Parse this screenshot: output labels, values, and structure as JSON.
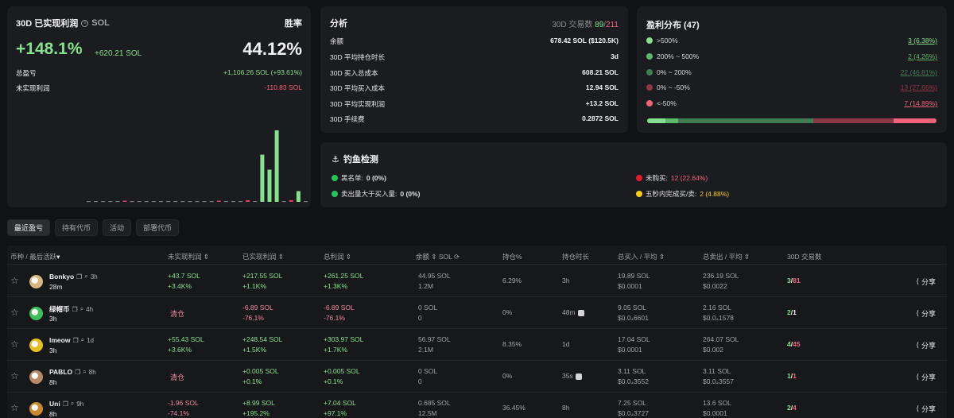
{
  "pnl_card": {
    "title": "30D 已实现利润",
    "currency": "SOL",
    "winrate_label": "胜率",
    "realized_pct": "+148.1%",
    "realized_sol": "+620.21 SOL",
    "winrate_value": "44.12%",
    "total_pnl_label": "总盈亏",
    "total_pnl_value": "+1,106.26 SOL (+93.61%)",
    "unrealized_label": "未实现利润",
    "unrealized_value": "-110.83 SOL",
    "bars": [
      0,
      0,
      0,
      0,
      0,
      0.012,
      0,
      0,
      0,
      0,
      0,
      0,
      0,
      0,
      0,
      0,
      0,
      0,
      0.012,
      0,
      0,
      0,
      0.024,
      0,
      0.66,
      0.45,
      1.0,
      0,
      0.024,
      0.15,
      0
    ],
    "bar_colors": {
      "positive": "#86e08e",
      "negative": "#e0405c",
      "neutral": "#7a7b80"
    }
  },
  "analysis": {
    "title": "分析",
    "trades_label": "30D 交易数",
    "trades_win": "89",
    "trades_sep": "/",
    "trades_total": "211",
    "rows": [
      {
        "label": "余额",
        "value": "678.42 SOL ($120.5K)"
      },
      {
        "label": "30D 平均持仓时长",
        "value": "3d"
      },
      {
        "label": "30D 买入总成本",
        "value": "608.21 SOL"
      },
      {
        "label": "30D 平均买入成本",
        "value": "12.94 SOL"
      },
      {
        "label": "30D 平均实现利润",
        "value": "+13.2 SOL"
      },
      {
        "label": "30D 手续费",
        "value": "0.2872 SOL"
      }
    ]
  },
  "profit_dist": {
    "title": "盈利分布 (47)",
    "rows": [
      {
        "label": ">500%",
        "count": "3 (6.38%)",
        "color": "#86e08e",
        "share": 0.0638
      },
      {
        "label": "200% ~ 500%",
        "count": "2 (4.26%)",
        "color": "#5cb86a",
        "share": 0.0426
      },
      {
        "label": "0% ~ 200%",
        "count": "22 (46.81%)",
        "color": "#3f7d52",
        "share": 0.4681
      },
      {
        "label": "0% ~ -50%",
        "count": "13 (27.66%)",
        "color": "#8f3646",
        "share": 0.2766
      },
      {
        "label": "<-50%",
        "count": "7 (14.89%)",
        "color": "#f2637b",
        "share": 0.1489
      }
    ]
  },
  "phishing": {
    "title": "钓鱼检测",
    "items": [
      {
        "label": "黑名单:",
        "value": "0 (0%)",
        "color": "#22c55e"
      },
      {
        "label": "卖出量大于买入量:",
        "value": "0 (0%)",
        "color": "#22c55e"
      },
      {
        "label": "未购买:",
        "value": "12 (22.64%)",
        "color": "#e11d2e"
      },
      {
        "label": "五秒内完成买/卖:",
        "value": "2 (4.88%)",
        "color": "#facc15"
      }
    ]
  },
  "tabs": [
    "最近盈亏",
    "持有代币",
    "活动",
    "部署代币"
  ],
  "table": {
    "headers": {
      "token": "币种 /",
      "last_active": "最后活跃",
      "unrealized": "未实现利润",
      "realized": "已实现利润",
      "total": "总利润",
      "balance": "余额",
      "balance_unit": "SOL",
      "position": "持仓%",
      "hold": "持仓时长",
      "bought": "总买入 / 平均",
      "sold": "总卖出 / 平均",
      "trades": "30D 交易数"
    },
    "share_label": "分享",
    "rows": [
      {
        "name": "Bonkyo",
        "created": "3h",
        "last": "28m",
        "avatar": "#d9b880",
        "unreal1": "+43.7 SOL",
        "unreal2": "+3.4K%",
        "unreal_cleared": "",
        "real1": "+217.55 SOL",
        "real2": "+1.1K%",
        "total1": "+261.25 SOL",
        "total2": "+1.3K%",
        "bal1": "44.95 SOL",
        "bal2": "1.2M",
        "pos": "6.29%",
        "hold": "3h",
        "buy1": "19.89 SOL",
        "buy2": "$0.0001",
        "sell1": "236.19 SOL",
        "sell2": "$0.0022",
        "tw": "3",
        "tt": "81",
        "neg": false
      },
      {
        "name": "绿帽币",
        "created": "4h",
        "last": "3h",
        "avatar": "#3fbf5a",
        "unreal1": "",
        "unreal2": "",
        "unreal_cleared": "清仓",
        "real1": "-6.89 SOL",
        "real2": "-76.1%",
        "total1": "-6.89 SOL",
        "total2": "-76.1%",
        "bal1": "0 SOL",
        "bal2": "0",
        "pos": "0%",
        "hold": "48m",
        "buy1": "9.05 SOL",
        "buy2": "$0.0₄6601",
        "sell1": "2.16 SOL",
        "sell2": "$0.0₄1578",
        "tw": "2",
        "tt": "1",
        "neg": true
      },
      {
        "name": "lmeow",
        "created": "1d",
        "last": "3h",
        "avatar": "#e6c020",
        "unreal1": "+55.43 SOL",
        "unreal2": "+3.6K%",
        "unreal_cleared": "",
        "real1": "+248.54 SOL",
        "real2": "+1.5K%",
        "total1": "+303.97 SOL",
        "total2": "+1.7K%",
        "bal1": "56.97 SOL",
        "bal2": "2.1M",
        "pos": "8.35%",
        "hold": "1d",
        "buy1": "17.04 SOL",
        "buy2": "$0.0001",
        "sell1": "264.07 SOL",
        "sell2": "$0.002",
        "tw": "4",
        "tt": "45",
        "neg": false
      },
      {
        "name": "PABLO",
        "created": "8h",
        "last": "8h",
        "avatar": "#b98a6a",
        "unreal1": "",
        "unreal2": "",
        "unreal_cleared": "清仓",
        "real1": "+0.005 SOL",
        "real2": "+0.1%",
        "total1": "+0.005 SOL",
        "total2": "+0.1%",
        "bal1": "0 SOL",
        "bal2": "0",
        "pos": "0%",
        "hold": "35s",
        "buy1": "3.11 SOL",
        "buy2": "$0.0₄3552",
        "sell1": "3.11 SOL",
        "sell2": "$0.0₄3557",
        "tw": "1",
        "tt": "1",
        "neg": false
      },
      {
        "name": "Uni",
        "created": "9h",
        "last": "8h",
        "avatar": "#c98a30",
        "unreal1": "-1.96 SOL",
        "unreal2": "-74.1%",
        "unreal_cleared": "",
        "real1": "+8.99 SOL",
        "real2": "+195.2%",
        "total1": "+7.04 SOL",
        "total2": "+97.1%",
        "bal1": "0.685 SOL",
        "bal2": "12.5M",
        "pos": "36.45%",
        "hold": "8h",
        "buy1": "7.25 SOL",
        "buy2": "$0.0₄3727",
        "sell1": "13.6 SOL",
        "sell2": "$0.0001",
        "tw": "2",
        "tt": "4",
        "neg": false
      }
    ]
  }
}
